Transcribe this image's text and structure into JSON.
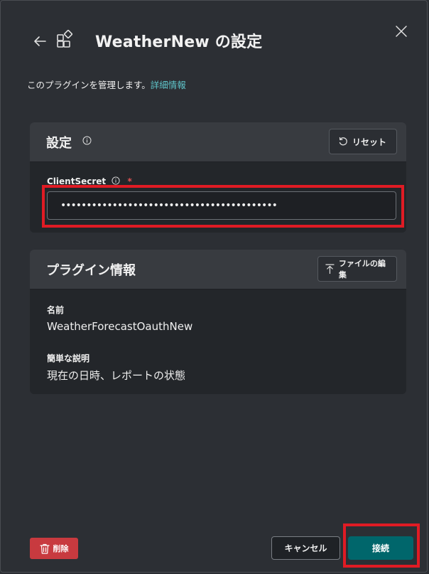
{
  "dialog": {
    "title": "WeatherNew の設定",
    "description": "このプラグインを管理します。",
    "learn_more": "詳細情報"
  },
  "settings": {
    "title": "設定",
    "reset_label": "リセット",
    "client_secret_label": "ClientSecret",
    "required_mark": "*",
    "client_secret_value": "••••••••••••••••••••••••••••••••••••••••••"
  },
  "plugin_info": {
    "title": "プラグイン情報",
    "edit_file_label": "ファイルの編集",
    "name_label": "名前",
    "name_value": "WeatherForecastOauthNew",
    "short_desc_label": "簡単な説明",
    "short_desc_value": "現在の日時、レポートの状態"
  },
  "footer": {
    "delete_label": "削除",
    "cancel_label": "キャンセル",
    "connect_label": "接続"
  },
  "colors": {
    "accent": "#00666b",
    "link": "#5fc4c9",
    "danger": "#c83a3f",
    "highlight": "#e01b24"
  },
  "icons": {
    "back": "arrow-left-icon",
    "plugin": "puzzle-blocks-icon",
    "close": "close-icon",
    "info": "info-icon",
    "reset": "reset-icon",
    "upload": "upload-icon",
    "delete": "trash-icon"
  }
}
